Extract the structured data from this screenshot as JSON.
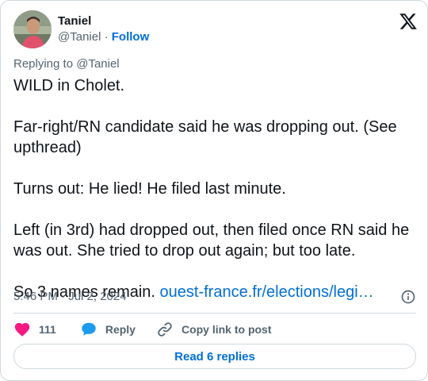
{
  "author": {
    "name": "Taniel",
    "handle": "@Taniel",
    "separator": "·",
    "follow_label": "Follow"
  },
  "reply_context": "Replying to @Taniel",
  "tweet": {
    "text": "WILD in Cholet.\n\nFar-right/RN candidate said he was dropping out. (See upthread)\n\nTurns out: He lied! He filed last minute.\n\nLeft (in 3rd) had dropped out, then filed once RN said he was out. She tried to drop out again; but too late.\n\nSo 3 names remain. ",
    "link_text": "ouest-france.fr/elections/legi…"
  },
  "timestamp": "5:46 PM · Jul 2, 2024",
  "actions": {
    "like_count": "111",
    "reply_label": "Reply",
    "copy_label": "Copy link to post"
  },
  "read_replies_label": "Read 6 replies",
  "icons": {
    "brand": "x-logo-icon",
    "info": "info-icon",
    "like": "heart-icon",
    "reply": "speech-bubble-icon",
    "copy": "link-icon"
  },
  "colors": {
    "link": "#006fd6",
    "heart": "#f91880",
    "reply_bubble": "#1d9bf0",
    "secondary_text": "#536471",
    "border": "#cfd9de"
  }
}
